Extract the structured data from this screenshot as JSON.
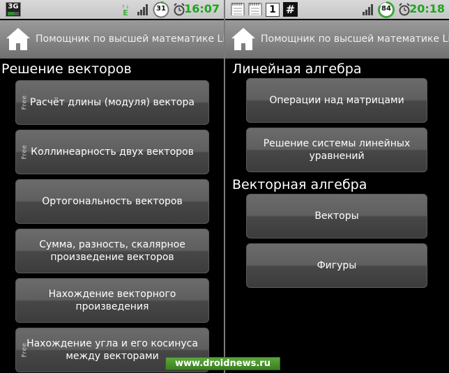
{
  "left": {
    "status": {
      "network": "3G",
      "battery": "31",
      "time": "16:07"
    },
    "title": "Помощник по высшей математике Lite",
    "section": "Решение векторов",
    "buttons": [
      {
        "label": "Расчёт длины (модуля) вектора",
        "badge": "Free"
      },
      {
        "label": "Коллинеарность двух векторов",
        "badge": "Free"
      },
      {
        "label": "Ортогональность векторов",
        "badge": ""
      },
      {
        "label": "Сумма, разность, скалярное произведение векторов",
        "badge": ""
      },
      {
        "label": "Нахождение векторного произведения",
        "badge": ""
      },
      {
        "label": "Нахождение угла и его косинуса между векторами",
        "badge": "Free"
      }
    ]
  },
  "right": {
    "status": {
      "notif_number": "1",
      "notif_hash": "#",
      "battery": "84",
      "time": "20:18"
    },
    "title": "Помощник по высшей математике Lite",
    "section1": "Линейная алгебра",
    "buttons1": [
      {
        "label": "Операции над матрицами"
      },
      {
        "label": "Решение системы линейных уравнений"
      }
    ],
    "section2": "Векторная алгебра",
    "buttons2": [
      {
        "label": "Векторы"
      },
      {
        "label": "Фигуры"
      }
    ]
  },
  "watermark": "www.droidnews.ru",
  "colors": {
    "time": "#1ea51e",
    "titlebar": "#808080",
    "button": "#555555"
  }
}
